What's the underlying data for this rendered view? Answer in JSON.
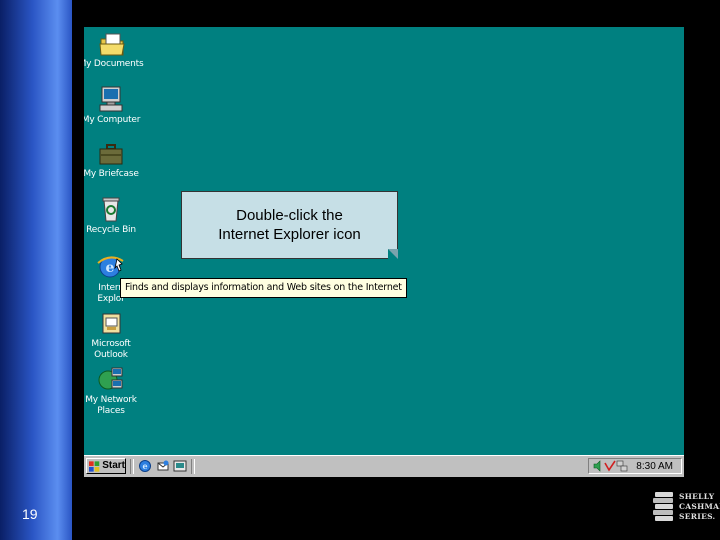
{
  "slide": {
    "number": "19"
  },
  "desktop": {
    "icons": [
      {
        "label": "My Documents",
        "icon": "folder-documents-icon"
      },
      {
        "label": "My Computer",
        "icon": "computer-icon"
      },
      {
        "label": "My Briefcase",
        "icon": "briefcase-icon"
      },
      {
        "label": "Recycle Bin",
        "icon": "recycle-bin-icon"
      },
      {
        "label": "Internet Explorer",
        "label_line1": "Intern",
        "label_line2": "Explor",
        "icon": "internet-explorer-icon"
      },
      {
        "label": "Microsoft Outlook",
        "label_line1": "Microsoft",
        "label_line2": "Outlook",
        "icon": "outlook-icon"
      },
      {
        "label": "My Network Places",
        "label_line1": "My Network",
        "label_line2": "Places",
        "icon": "network-places-icon"
      }
    ],
    "background_color": "#008080"
  },
  "callout": {
    "line1": "Double-click the",
    "line2": "Internet Explorer icon"
  },
  "tooltip": {
    "text": "Finds and displays information and Web sites on the Internet"
  },
  "taskbar": {
    "start_label": "Start",
    "quick_launch": [
      "internet-explorer-icon",
      "outlook-express-icon",
      "show-desktop-icon"
    ],
    "tray_icons": [
      "speaker-icon",
      "scheduler-icon",
      "network-icon"
    ],
    "clock": "8:30 AM"
  },
  "logo": {
    "line1": "SHELLY",
    "line2": "CASHMAN",
    "line3": "SERIES."
  }
}
